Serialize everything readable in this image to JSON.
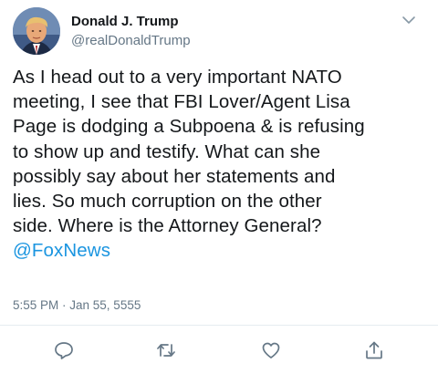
{
  "author": {
    "display_name": "Donald J. Trump",
    "handle": "@realDonaldTrump"
  },
  "tweet": {
    "lines": [
      "As I head out to a very important NATO",
      "meeting, I see that FBI Lover/Agent Lisa",
      "Page is dodging a Subpoena & is refusing",
      "to show up and testify. What can she",
      "possibly say about her statements and",
      "lies. So much corruption on the other",
      "side. Where is the Attorney General?"
    ],
    "mention": "@FoxNews",
    "timestamp": "5:55 PM · Jan 55, 5555"
  },
  "icons": {
    "menu": "chevron-down-icon",
    "actions": [
      "reply-icon",
      "retweet-icon",
      "like-icon",
      "share-icon"
    ]
  },
  "colors": {
    "text": "#14171a",
    "secondary": "#657786",
    "link": "#1b95e0",
    "divider": "#e6ecf0"
  }
}
